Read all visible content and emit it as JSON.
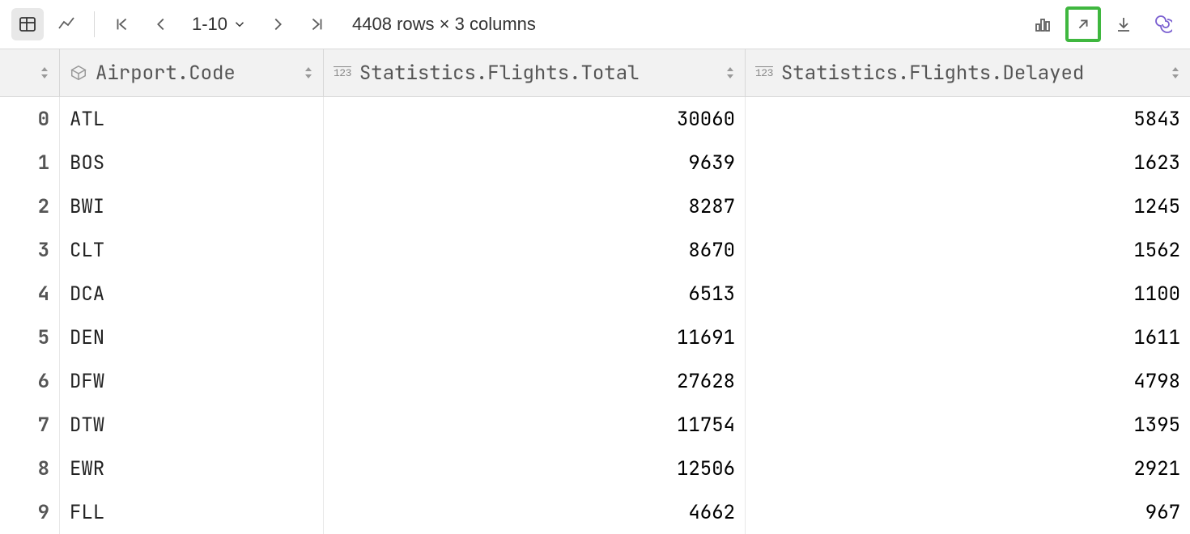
{
  "toolbar": {
    "range_label": "1-10",
    "status": "4408 rows × 3 columns"
  },
  "columns": [
    {
      "name": "Airport.Code",
      "type": "object"
    },
    {
      "name": "Statistics.Flights.Total",
      "type": "number"
    },
    {
      "name": "Statistics.Flights.Delayed",
      "type": "number"
    }
  ],
  "type_glyph_number": "123",
  "rows": [
    {
      "idx": "0",
      "code": "ATL",
      "total": "30060",
      "delayed": "5843"
    },
    {
      "idx": "1",
      "code": "BOS",
      "total": "9639",
      "delayed": "1623"
    },
    {
      "idx": "2",
      "code": "BWI",
      "total": "8287",
      "delayed": "1245"
    },
    {
      "idx": "3",
      "code": "CLT",
      "total": "8670",
      "delayed": "1562"
    },
    {
      "idx": "4",
      "code": "DCA",
      "total": "6513",
      "delayed": "1100"
    },
    {
      "idx": "5",
      "code": "DEN",
      "total": "11691",
      "delayed": "1611"
    },
    {
      "idx": "6",
      "code": "DFW",
      "total": "27628",
      "delayed": "4798"
    },
    {
      "idx": "7",
      "code": "DTW",
      "total": "11754",
      "delayed": "1395"
    },
    {
      "idx": "8",
      "code": "EWR",
      "total": "12506",
      "delayed": "2921"
    },
    {
      "idx": "9",
      "code": "FLL",
      "total": "4662",
      "delayed": "967"
    }
  ]
}
